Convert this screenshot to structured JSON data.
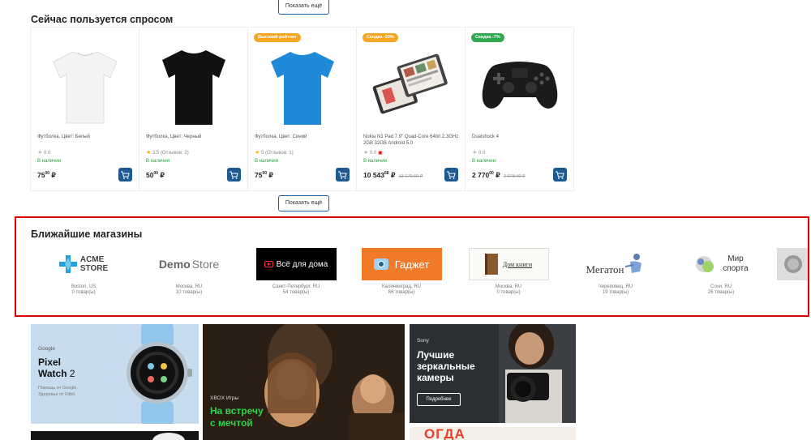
{
  "show_more_label": "Показать ещё",
  "popular": {
    "title": "Сейчас пользуется спросом",
    "products": [
      {
        "name": "Футболка, Цвет: Белый",
        "rating": "0.0",
        "stock": "В наличии",
        "price": "75",
        "price_cents": "00",
        "currency": "₽",
        "old_price": "",
        "badge": "",
        "image": "white-tshirt"
      },
      {
        "name": "Футболка, Цвет: Черный",
        "rating": "3.5 (Отзывов: 2)",
        "stock": "В наличии",
        "price": "50",
        "price_cents": "00",
        "currency": "₽",
        "old_price": "",
        "badge": "",
        "image": "black-tshirt"
      },
      {
        "name": "Футболка, Цвет: Синий",
        "rating": "5 (Отзывов: 1)",
        "stock": "В наличии",
        "price": "75",
        "price_cents": "00",
        "currency": "₽",
        "old_price": "",
        "badge": "Высокий рейтинг",
        "badge_color": "#f5a623",
        "image": "blue-tshirt"
      },
      {
        "name": "Nokia N1 Pad 7.9\" Quad-Core 64bit 2.3GHz 2GB 32GB Android 5.0",
        "rating": "0.0",
        "stock": "В наличии",
        "price": "10 543",
        "price_cents": "68",
        "currency": "₽",
        "old_price": "13 179,60 ₽",
        "badge": "Скидка -20%",
        "badge_color": "#f5a623",
        "image": "tablets"
      },
      {
        "name": "Dualshock 4",
        "rating": "0.0",
        "stock": "В наличии",
        "price": "2 770",
        "price_cents": "00",
        "currency": "₽",
        "old_price": "2 978,49 ₽",
        "badge": "Скидка -7%",
        "badge_color": "#2fa84f",
        "image": "gamepad"
      }
    ]
  },
  "stores": {
    "title": "Ближайшие магазины",
    "items": [
      {
        "name_line1": "ACME",
        "name_line2": "STORE",
        "city": "Boston, US",
        "count": "0 товар(ы)"
      },
      {
        "name_line1": "Demo",
        "name_line2": "Store",
        "city": "Москва, RU",
        "count": "10 товар(ы)"
      },
      {
        "name_line1": "Всё для дома",
        "city": "Санкт-Петербург, RU",
        "count": "54 товар(ы)"
      },
      {
        "name_line1": "Гаджет",
        "city": "Калининград, RU",
        "count": "86 товар(ы)"
      },
      {
        "name_line1": "Дом книги",
        "city": "Москва, RU",
        "count": "0 товар(ы)"
      },
      {
        "name_line1": "Мегатон",
        "city": "Череповец, RU",
        "count": "19 товар(ы)"
      },
      {
        "name_line1": "Мир",
        "name_line2": "спорта",
        "city": "Сочи, RU",
        "count": "26 товар(ы)"
      }
    ]
  },
  "banners": {
    "pixel": {
      "brand": "Google",
      "title_line1": "Pixel",
      "title_line2": "Watch",
      "title_num": "2",
      "sub_line1": "Помощь от Google.",
      "sub_line2": "Здоровье от Fitbit."
    },
    "xbox": {
      "brand": "XBOX Игры",
      "title_line1": "На встречу",
      "title_line2": "с мечтой"
    },
    "sony": {
      "brand": "Sony",
      "title_line1": "Лучшие",
      "title_line2": "зеркальные",
      "title_line3": "камеры",
      "button": "Подробнее"
    },
    "bottom2": {
      "text": "ОГДА"
    }
  },
  "colors": {
    "cart": "#1d5a92",
    "stock": "#2a9d3a",
    "accent_border": "#e00000",
    "xbox_green": "#2fd34f"
  }
}
